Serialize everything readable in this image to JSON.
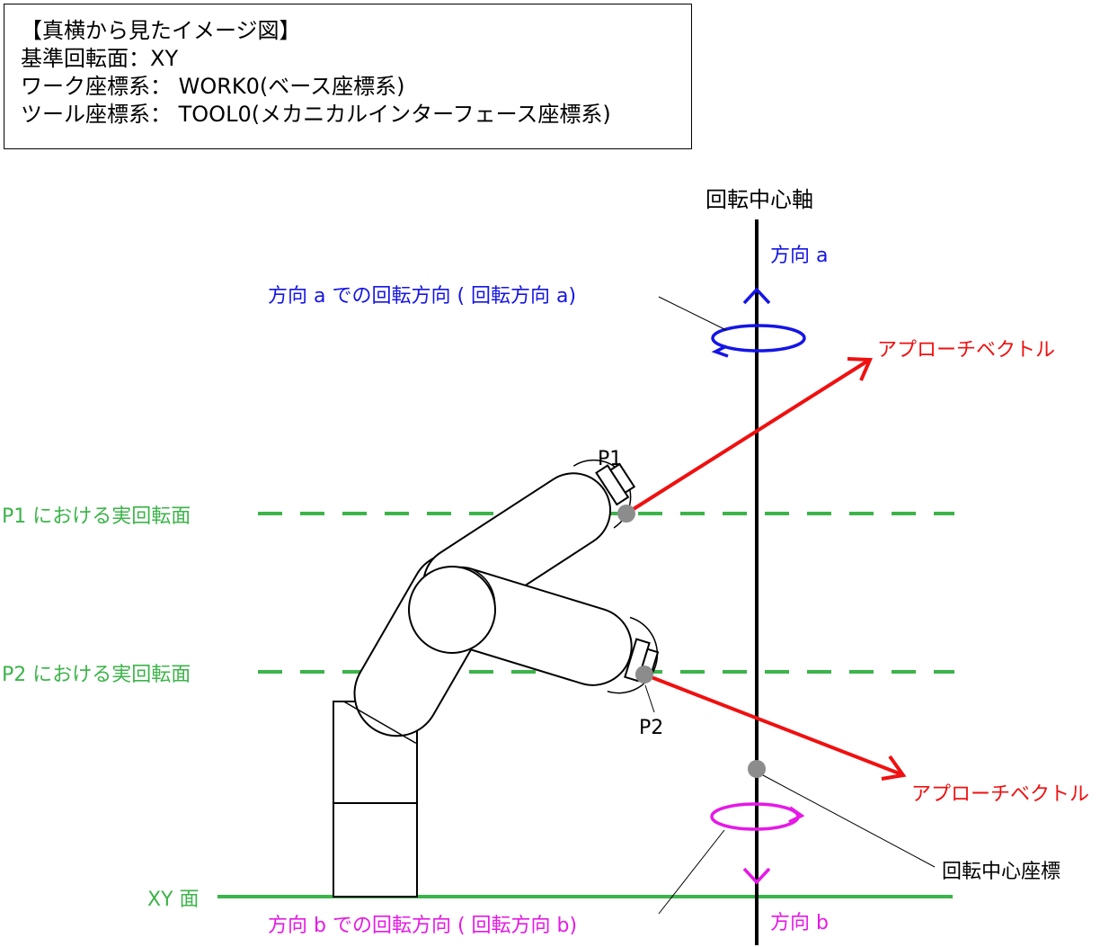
{
  "info_box": {
    "title": "【真横から見たイメージ図】",
    "reference_plane": "基準回転面：XY",
    "work_frame": "ワーク座標系： WORK0(ベース座標系)",
    "tool_frame": "ツール座標系： TOOL0(メカニカルインターフェース座標系)"
  },
  "labels": {
    "rotation_axis": "回転中心軸",
    "direction_a": "方向 a",
    "direction_b": "方向 b",
    "rotation_a": "方向 a での回転方向 ( 回転方向 a)",
    "rotation_b": "方向 b での回転方向 ( 回転方向 b)",
    "approach_vector_1": "アプローチベクトル",
    "approach_vector_2": "アプローチベクトル",
    "p1": "P1",
    "p2": "P2",
    "p1_plane": "P1 における実回転面",
    "p2_plane": "P2 における実回転面",
    "xy_plane": "XY 面",
    "rotation_center": "回転中心座標"
  },
  "colors": {
    "axis": "#000000",
    "direction_a": "#1515e6",
    "direction_b": "#e619e6",
    "approach_vector": "#f01010",
    "plane": "#3cb44a",
    "point": "#8c8c8c"
  }
}
